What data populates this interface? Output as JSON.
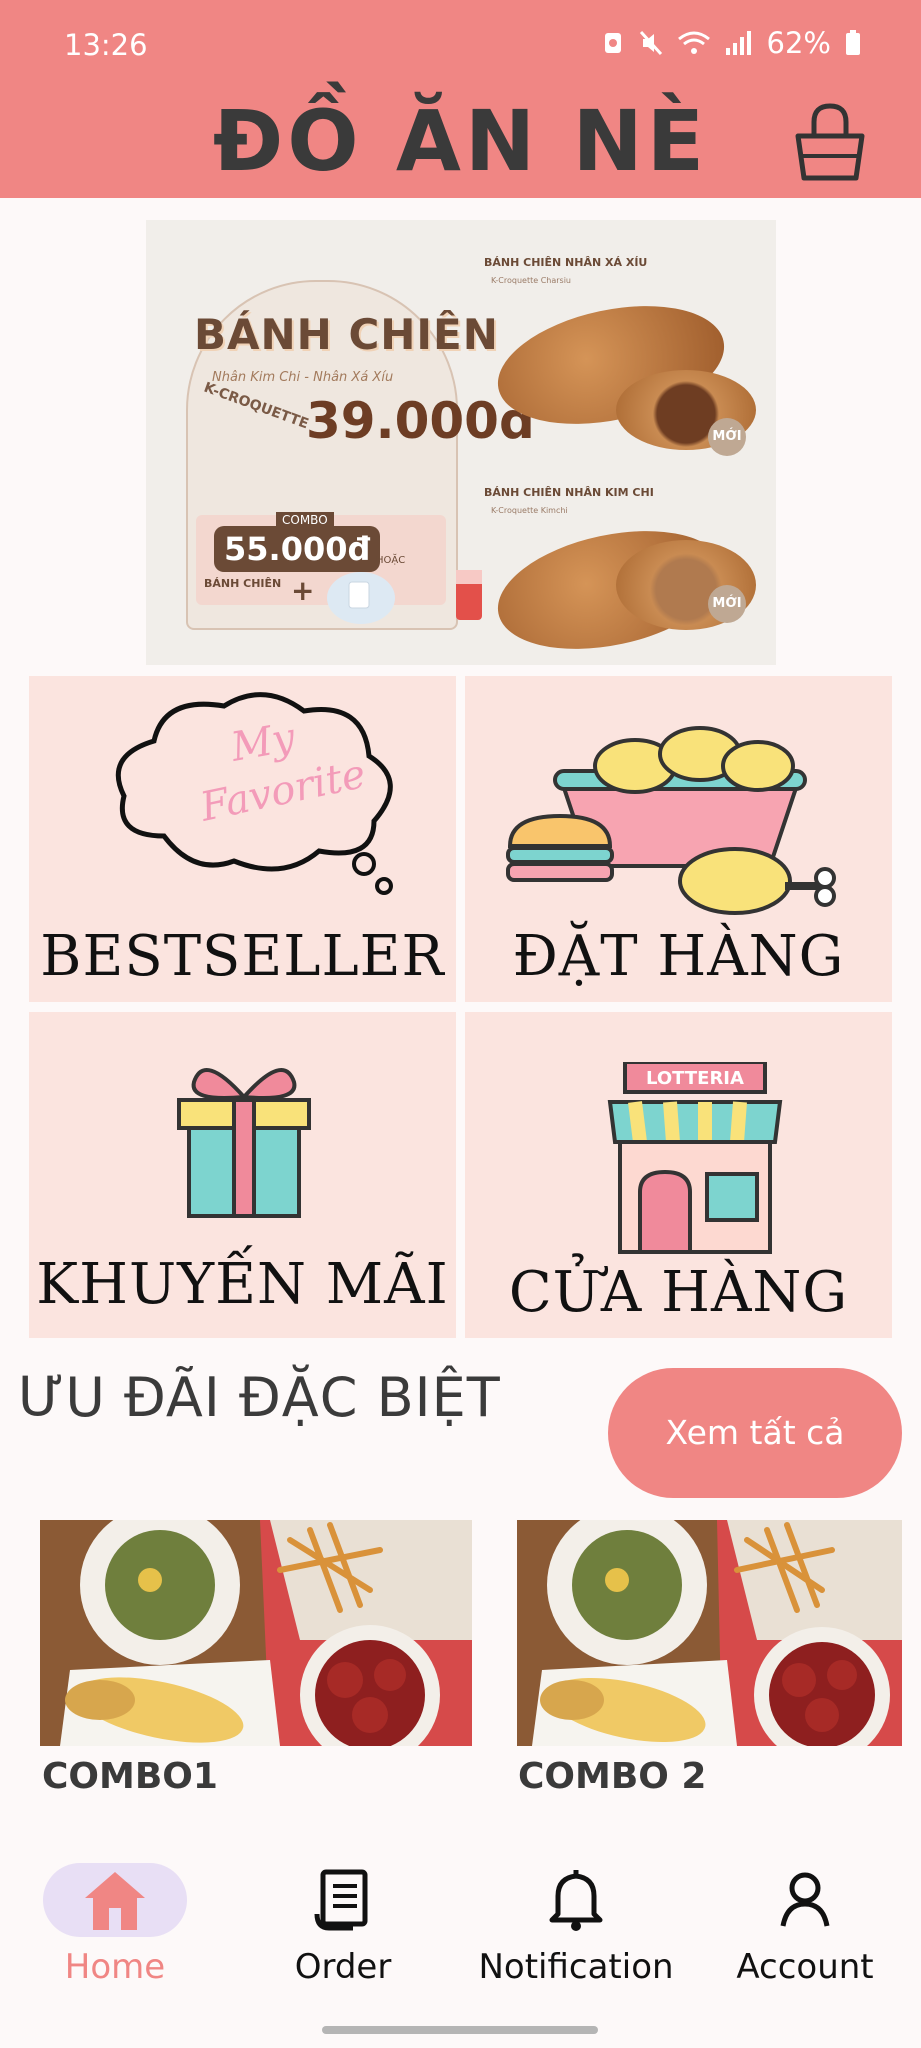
{
  "status_bar": {
    "time": "13:26",
    "battery": "62%"
  },
  "header": {
    "title": "ĐỒ ĂN NÈ",
    "accent_color": "#f08684"
  },
  "banner": {
    "title": "BÁNH CHIÊN",
    "subtitle": "Nhân Kim Chi - Nhân Xá Xíu",
    "product_line": "K-CROQUETTE",
    "price": "39.000đ",
    "combo_tag": "COMBO",
    "combo_price": "55.000đ",
    "combo_item": "BÁNH CHIÊN",
    "combo_or": "HOẶC",
    "products": [
      {
        "name": "BÁNH CHIÊN NHÂN XÁ XÍU",
        "sub": "K-Croquette Charsiu",
        "badge": "MỚI"
      },
      {
        "name": "BÁNH CHIÊN NHÂN KIM CHI",
        "sub": "K-Croquette Kimchi",
        "badge": "MỚI"
      }
    ]
  },
  "categories": [
    {
      "label": "BESTSELLER",
      "art_text_1": "My",
      "art_text_2": "Favorite"
    },
    {
      "label": "ĐẶT HÀNG"
    },
    {
      "label": "KHUYẾN MÃI"
    },
    {
      "label": "CỬA HÀNG",
      "art_text_1": "LOTTERIA"
    }
  ],
  "special": {
    "title": "ƯU ĐÃI ĐẶC BIỆT",
    "see_all": "Xem tất cả",
    "combos": [
      {
        "name": "COMBO1"
      },
      {
        "name": "COMBO 2"
      }
    ]
  },
  "bottom_nav": [
    {
      "label": "Home",
      "icon": "home-icon",
      "active": true
    },
    {
      "label": "Order",
      "icon": "receipt-icon",
      "active": false
    },
    {
      "label": "Notification",
      "icon": "bell-icon",
      "active": false
    },
    {
      "label": "Account",
      "icon": "person-icon",
      "active": false
    }
  ]
}
